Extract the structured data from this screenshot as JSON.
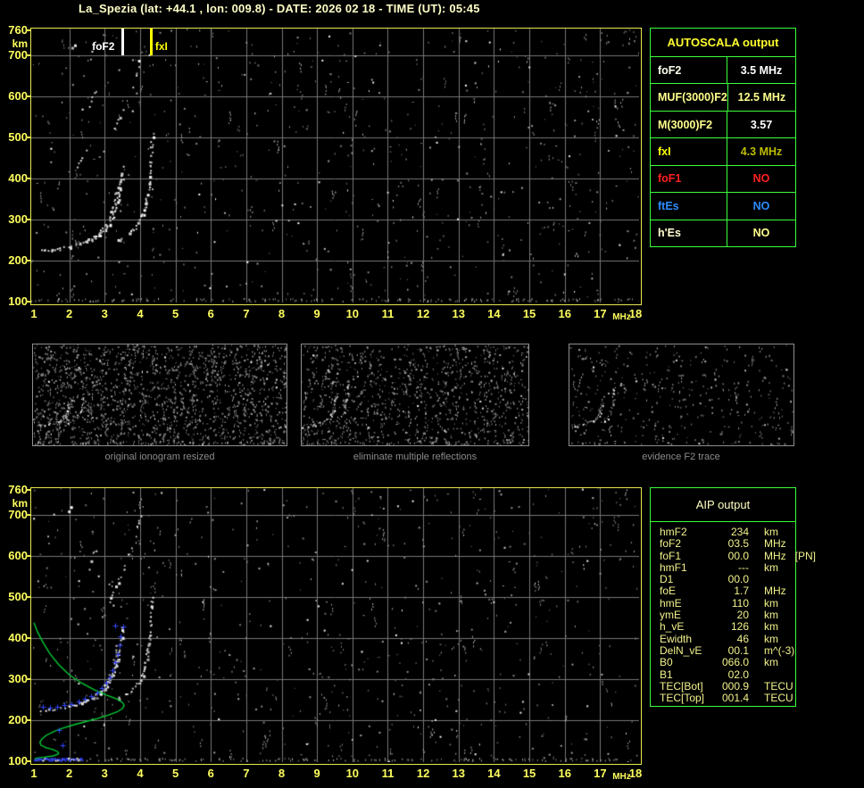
{
  "title": "La_Spezia (lat: +44.1 , lon: 009.8) - DATE: 2026 02 18 - TIME (UT): 05:45",
  "colors": {
    "background": "#000000",
    "title_text": "#ffffc6",
    "axis_text": "#ffff5e",
    "plot_border": "#e8e850",
    "grid": "#777777",
    "table_border": "#3aff3a",
    "caption_text": "#8c8c8c",
    "profile_green": "#00cc33",
    "trace_blue": "#3344ff"
  },
  "axis": {
    "x_ticks": [
      "1",
      "2",
      "3",
      "4",
      "5",
      "6",
      "7",
      "8",
      "9",
      "10",
      "11",
      "12",
      "13",
      "14",
      "15",
      "16",
      "17",
      "18"
    ],
    "x_unit": "MHz",
    "y_ticks": [
      "760",
      "700",
      "600",
      "500",
      "400",
      "300",
      "200",
      "100"
    ],
    "y_tick_values": [
      760,
      700,
      600,
      500,
      400,
      300,
      200,
      100
    ],
    "y_unit": "km",
    "f_min": 1,
    "f_max": 18,
    "km_min": 100,
    "km_max": 760
  },
  "top_plot": {
    "markers": [
      {
        "label": "foF2",
        "f": 3.5,
        "color": "#ffffff",
        "label_side": "left"
      },
      {
        "label": "fxI",
        "f": 4.3,
        "color": "#ffff00",
        "label_side": "right"
      }
    ]
  },
  "autoscala_table": {
    "title": "AUTOSCALA output",
    "rows": [
      {
        "label": "foF2",
        "value": "3.5 MHz",
        "label_color": "#fdfdee",
        "value_color": "#ffffff"
      },
      {
        "label": "MUF(3000)F2",
        "value": "12.5 MHz",
        "label_color": "#ffff8c",
        "value_color": "#ffff8c"
      },
      {
        "label": "M(3000)F2",
        "value": "3.57",
        "label_color": "#ffff8c",
        "value_color": "#ffffff"
      },
      {
        "label": "fxI",
        "value": "4.3 MHz",
        "label_color": "#ffff00",
        "value_color": "#bdbd00"
      },
      {
        "label": "foF1",
        "value": "NO",
        "label_color": "#ff2020",
        "value_color": "#ff2020"
      },
      {
        "label": "ftEs",
        "value": "NO",
        "label_color": "#2e8cff",
        "value_color": "#2e8cff"
      },
      {
        "label": "h'Es",
        "value": "NO",
        "label_color": "#ffffd0",
        "value_color": "#ffff8c"
      }
    ]
  },
  "thumbnails": [
    {
      "caption": "original ionogram resized"
    },
    {
      "caption": "eliminate multiple reflections"
    },
    {
      "caption": "evidence F2 trace"
    }
  ],
  "aip_table": {
    "title": "AIP output",
    "rows": [
      {
        "label": "hmF2",
        "value": "234",
        "unit": "km"
      },
      {
        "label": "foF2",
        "value": "03.5",
        "unit": "MHz"
      },
      {
        "label": "foF1",
        "value": "00.0",
        "unit": "MHz   [PN]"
      },
      {
        "label": "hmF1",
        "value": "---",
        "unit": "km"
      },
      {
        "label": "D1",
        "value": "00.0",
        "unit": ""
      },
      {
        "label": "foE",
        "value": "1.7",
        "unit": "MHz"
      },
      {
        "label": "hmE",
        "value": "110",
        "unit": "km"
      },
      {
        "label": "ymE",
        "value": "20",
        "unit": "km"
      },
      {
        "label": "h_vE",
        "value": "126",
        "unit": "km"
      },
      {
        "label": "Ewidth",
        "value": "46",
        "unit": "km"
      },
      {
        "label": "DelN_vE",
        "value": "00.1",
        "unit": "m^(-3)"
      },
      {
        "label": "B0",
        "value": "066.0",
        "unit": "km"
      },
      {
        "label": "B1",
        "value": "02.0",
        "unit": ""
      },
      {
        "label": "TEC[Bot]",
        "value": "000.9",
        "unit": "TECU"
      },
      {
        "label": "TEC[Top]",
        "value": "001.4",
        "unit": "TECU"
      }
    ]
  },
  "ionogram": {
    "o_trace": [
      [
        1.2,
        226
      ],
      [
        1.45,
        227
      ],
      [
        1.7,
        230
      ],
      [
        2.0,
        235
      ],
      [
        2.3,
        242
      ],
      [
        2.6,
        251
      ],
      [
        2.85,
        263
      ],
      [
        3.0,
        276
      ],
      [
        3.12,
        291
      ],
      [
        3.22,
        308
      ],
      [
        3.3,
        328
      ],
      [
        3.37,
        352
      ],
      [
        3.42,
        378
      ],
      [
        3.46,
        405
      ],
      [
        3.49,
        428
      ]
    ],
    "branch2": [
      [
        2.45,
        250
      ],
      [
        2.65,
        258
      ],
      [
        2.85,
        270
      ],
      [
        3.0,
        284
      ],
      [
        3.1,
        300
      ],
      [
        3.18,
        318
      ],
      [
        3.25,
        340
      ],
      [
        3.3,
        362
      ],
      [
        3.34,
        385
      ]
    ],
    "x_trace": [
      [
        3.35,
        252
      ],
      [
        3.6,
        262
      ],
      [
        3.8,
        276
      ],
      [
        3.95,
        294
      ],
      [
        4.07,
        316
      ],
      [
        4.15,
        342
      ],
      [
        4.21,
        372
      ],
      [
        4.26,
        405
      ],
      [
        4.29,
        440
      ],
      [
        4.31,
        475
      ],
      [
        4.33,
        508
      ]
    ],
    "hop_segments": [
      [
        [
          2.9,
          450
        ],
        [
          3.25,
          515
        ]
      ],
      [
        [
          3.3,
          525
        ],
        [
          3.6,
          585
        ]
      ],
      [
        [
          2.5,
          560
        ],
        [
          2.75,
          625
        ]
      ],
      [
        [
          3.65,
          595
        ],
        [
          3.85,
          650
        ]
      ],
      [
        [
          1.8,
          700
        ],
        [
          2.1,
          725
        ]
      ],
      [
        [
          2.2,
          430
        ],
        [
          2.45,
          470
        ]
      ],
      [
        [
          3.9,
          660
        ],
        [
          4.0,
          700
        ]
      ]
    ],
    "profile": [
      [
        1.0,
        437
      ],
      [
        1.1,
        415
      ],
      [
        1.25,
        390
      ],
      [
        1.45,
        362
      ],
      [
        1.7,
        335
      ],
      [
        2.0,
        310
      ],
      [
        2.35,
        290
      ],
      [
        2.7,
        274
      ],
      [
        3.05,
        261
      ],
      [
        3.35,
        251
      ],
      [
        3.5,
        243
      ],
      [
        3.55,
        236
      ],
      [
        3.5,
        228
      ],
      [
        3.35,
        220
      ],
      [
        3.1,
        212
      ],
      [
        2.8,
        204
      ],
      [
        2.45,
        196
      ],
      [
        2.1,
        188
      ],
      [
        1.8,
        180
      ],
      [
        1.55,
        172
      ],
      [
        1.35,
        163
      ],
      [
        1.22,
        154
      ],
      [
        1.17,
        146
      ],
      [
        1.2,
        139
      ],
      [
        1.35,
        133
      ],
      [
        1.55,
        128
      ],
      [
        1.68,
        123
      ],
      [
        1.7,
        118
      ],
      [
        1.55,
        113
      ],
      [
        1.3,
        110
      ],
      [
        1.1,
        108
      ],
      [
        1.02,
        106
      ]
    ],
    "blue_markers": [
      [
        1.25,
        233
      ],
      [
        1.45,
        231
      ],
      [
        1.65,
        232
      ],
      [
        1.85,
        236
      ],
      [
        2.05,
        240
      ],
      [
        2.25,
        246
      ],
      [
        2.45,
        252
      ],
      [
        2.62,
        259
      ],
      [
        2.78,
        268
      ],
      [
        2.92,
        279
      ],
      [
        3.04,
        291
      ],
      [
        3.14,
        305
      ],
      [
        3.22,
        321
      ],
      [
        3.3,
        340
      ],
      [
        3.36,
        360
      ],
      [
        3.41,
        382
      ],
      [
        3.45,
        405
      ],
      [
        1.7,
        176
      ],
      [
        1.8,
        140
      ],
      [
        3.52,
        428
      ],
      [
        3.3,
        430
      ]
    ],
    "blue_bottom_band": {
      "f_start": 1.0,
      "f_end": 2.35,
      "km": 106
    }
  }
}
